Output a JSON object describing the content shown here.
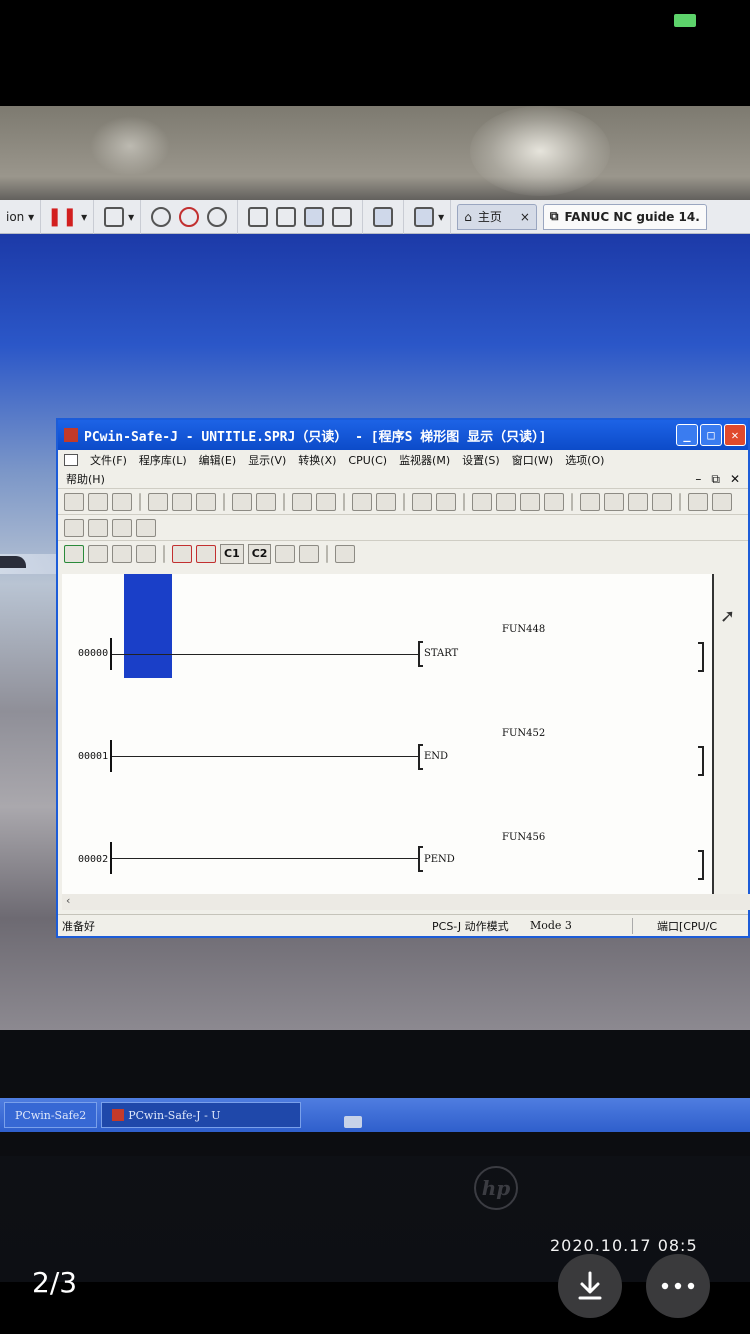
{
  "viewer": {
    "page_counter": "2/3",
    "timestamp": "2020.10.17 08:5",
    "download_icon": "download-icon",
    "more_icon": "more-icon"
  },
  "app_toolbar": {
    "left_label": "ion",
    "tab_home": "主页",
    "tab_fanuc": "FANUC NC guide 14."
  },
  "window": {
    "title": "PCwin-Safe-J - UNTITLE.SPRJ（只读） - [程序S 梯形图  显示（只读）]",
    "menus": [
      "文件(F)",
      "程序库(L)",
      "编辑(E)",
      "显示(V)",
      "转换(X)",
      "CPU(C)",
      "监视器(M)",
      "设置(S)",
      "窗口(W)",
      "选项(O)"
    ],
    "menu_help": "帮助(H)",
    "toolbar_c1": "C1",
    "toolbar_c2": "C2"
  },
  "ladder": {
    "rungs": [
      {
        "num": "00000",
        "instr": "START",
        "fun": "FUN448"
      },
      {
        "num": "00001",
        "instr": "END",
        "fun": "FUN452"
      },
      {
        "num": "00002",
        "instr": "PEND",
        "fun": "FUN456"
      }
    ]
  },
  "statusbar": {
    "ready": "准备好",
    "mode_label": "PCS-J 动作模式",
    "mode_value": "Mode 3",
    "port": "端口[CPU/C"
  },
  "taskbar": {
    "item1": "PCwin-Safe2",
    "item2": "PCwin-Safe-J - U"
  },
  "monitor_brand": "hp"
}
